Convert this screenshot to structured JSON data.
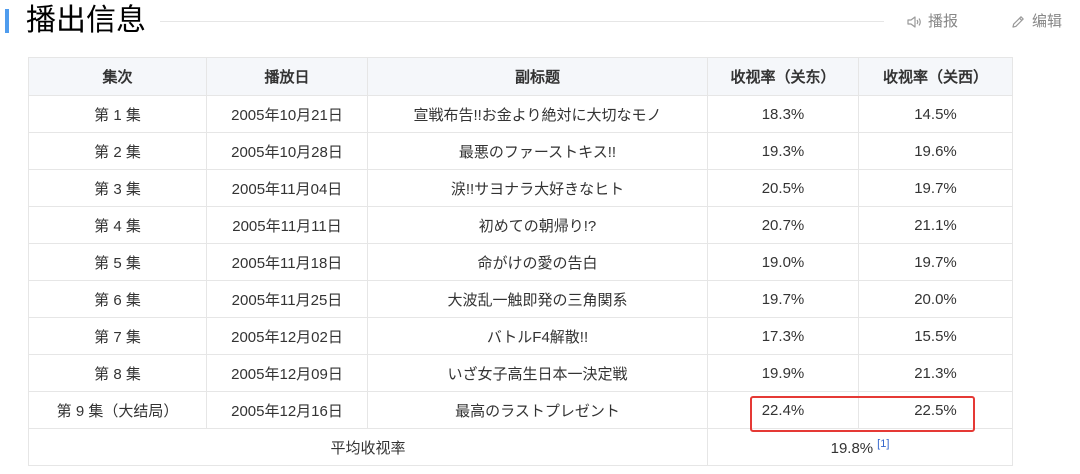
{
  "section": {
    "title": "播出信息",
    "actions": {
      "broadcast": "播报",
      "edit": "编辑"
    }
  },
  "table": {
    "headers": [
      "集次",
      "播放日",
      "副标题",
      "收视率（关东）",
      "收视率（关西）"
    ],
    "rows": [
      [
        "第 1 集",
        "2005年10月21日",
        "宣戦布告!!お金より絶対に大切なモノ",
        "18.3%",
        "14.5%"
      ],
      [
        "第 2 集",
        "2005年10月28日",
        "最悪のファーストキス!!",
        "19.3%",
        "19.6%"
      ],
      [
        "第 3 集",
        "2005年11月04日",
        "涙!!サヨナラ大好きなヒト",
        "20.5%",
        "19.7%"
      ],
      [
        "第 4 集",
        "2005年11月11日",
        "初めての朝帰り!?",
        "20.7%",
        "21.1%"
      ],
      [
        "第 5 集",
        "2005年11月18日",
        "命がけの愛の告白",
        "19.0%",
        "19.7%"
      ],
      [
        "第 6 集",
        "2005年11月25日",
        "大波乱一触即発の三角関系",
        "19.7%",
        "20.0%"
      ],
      [
        "第 7 集",
        "2005年12月02日",
        "バトルF4解散!!",
        "17.3%",
        "15.5%"
      ],
      [
        "第 8 集",
        "2005年12月09日",
        "いざ女子高生日本一決定戦",
        "19.9%",
        "21.3%"
      ],
      [
        "第 9 集（大结局）",
        "2005年12月16日",
        "最高のラストプレゼント",
        "22.4%",
        "22.5%"
      ]
    ],
    "average": {
      "label": "平均收视率",
      "value": "19.8%",
      "reference": "[1]"
    }
  },
  "colors": {
    "accent": "#4f9cee",
    "highlight": "#e53935",
    "link": "#3366cc"
  },
  "icons": {
    "broadcast": "speaker-icon",
    "edit": "pencil-icon"
  }
}
